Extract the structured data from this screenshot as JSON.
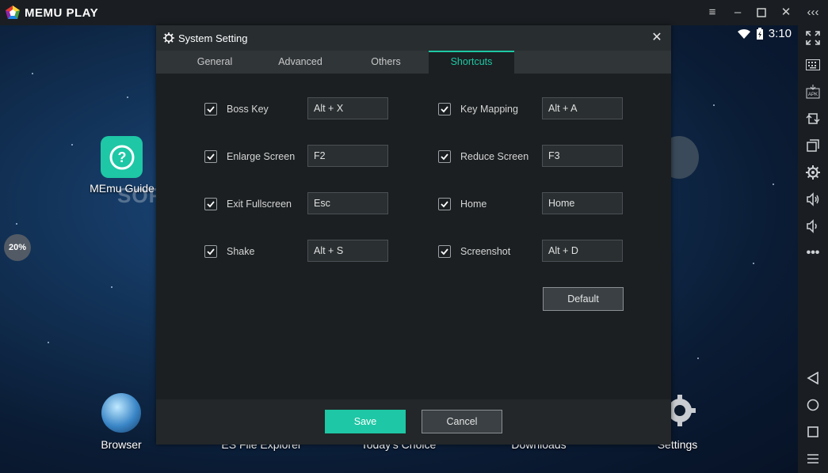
{
  "app": {
    "title": "MEMU PLAY"
  },
  "window_controls": {
    "menu_icon": "hamburger-icon",
    "minimize_icon": "minimize-icon",
    "maximize_icon": "maximize-icon",
    "close_icon": "close-icon",
    "collapse_icon": "chevrons-left-icon"
  },
  "status_bar": {
    "time": "3:10",
    "wifi_icon": "wifi-icon",
    "battery_icon": "battery-charging-icon"
  },
  "desktop": {
    "guide_label": "MEmu Guide",
    "progress_text": "20%",
    "dock": [
      {
        "label": "Browser"
      },
      {
        "label": "ES File Explorer"
      },
      {
        "label": "Today's Choice"
      },
      {
        "label": "Downloads"
      },
      {
        "label": "Settings"
      }
    ],
    "watermark": "SOFTPEDIA"
  },
  "dialog": {
    "title": "System Setting",
    "tabs": [
      {
        "label": "General"
      },
      {
        "label": "Advanced"
      },
      {
        "label": "Others"
      },
      {
        "label": "Shortcuts"
      }
    ],
    "active_tab": "Shortcuts",
    "shortcuts_left": [
      {
        "label": "Boss Key",
        "value": "Alt + X",
        "checked": true
      },
      {
        "label": "Enlarge Screen",
        "value": "F2",
        "checked": true
      },
      {
        "label": "Exit Fullscreen",
        "value": "Esc",
        "checked": true
      },
      {
        "label": "Shake",
        "value": "Alt + S",
        "checked": true
      }
    ],
    "shortcuts_right": [
      {
        "label": "Key Mapping",
        "value": "Alt + A",
        "checked": true
      },
      {
        "label": "Reduce Screen",
        "value": "F3",
        "checked": true
      },
      {
        "label": "Home",
        "value": "Home",
        "checked": true
      },
      {
        "label": "Screenshot",
        "value": "Alt + D",
        "checked": true
      }
    ],
    "default_button": "Default",
    "save_button": "Save",
    "cancel_button": "Cancel"
  },
  "sidebar": {
    "icons": [
      "fullscreen-icon",
      "keyboard-icon",
      "apk-install-icon",
      "rotate-icon",
      "multi-window-icon",
      "settings-icon",
      "volume-up-icon",
      "volume-down-icon",
      "more-icon",
      "back-icon",
      "home-icon",
      "recent-apps-icon",
      "menu-list-icon"
    ]
  },
  "colors": {
    "accent": "#1ec7a5",
    "titlebar": "#1a1e22",
    "dialog_body": "#1b1f21"
  }
}
